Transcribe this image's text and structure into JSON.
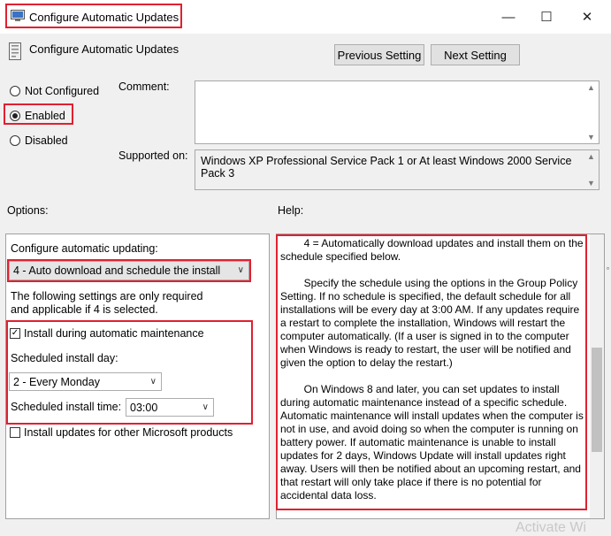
{
  "window": {
    "title": "Configure Automatic Updates",
    "controls": {
      "minimize": "—",
      "maximize": "☐",
      "close": "✕"
    }
  },
  "header": {
    "policy_name": "Configure Automatic Updates",
    "previous_label": "Previous Setting",
    "next_label": "Next Setting"
  },
  "state": {
    "options": [
      {
        "label": "Not Configured",
        "selected": false
      },
      {
        "label": "Enabled",
        "selected": true
      },
      {
        "label": "Disabled",
        "selected": false
      }
    ]
  },
  "comment": {
    "label": "Comment:",
    "value": ""
  },
  "supported": {
    "label": "Supported on:",
    "value": "Windows XP Professional Service Pack 1 or At least Windows 2000 Service Pack 3"
  },
  "options_section": {
    "label": "Options:",
    "configure_label": "Configure automatic updating:",
    "configure_value": "4 - Auto download and schedule the install",
    "note": "The following settings are only required and applicable if 4 is selected.",
    "maintenance_checkbox": {
      "label": "Install during automatic maintenance",
      "checked": true
    },
    "install_day_label": "Scheduled install day:",
    "install_day_value": "2 - Every Monday",
    "install_time_label": "Scheduled install time:",
    "install_time_value": "03:00",
    "other_products_checkbox": {
      "label": "Install updates for other Microsoft products",
      "checked": false
    }
  },
  "help": {
    "label": "Help:",
    "para1": "        4 = Automatically download updates and install them on the schedule specified below.",
    "para2": "        Specify the schedule using the options in the Group Policy Setting. If no schedule is specified, the default schedule for all installations will be every day at 3:00 AM. If any updates require a restart to complete the installation, Windows will restart the computer automatically. (If a user is signed in to the computer when Windows is ready to restart, the user will be notified and given the option to delay the restart.)",
    "para3": "        On Windows 8 and later, you can set updates to install during automatic maintenance instead of a specific schedule. Automatic maintenance will install updates when the computer is not in use, and avoid doing so when the computer is running on battery power. If automatic maintenance is unable to install updates for 2 days, Windows Update will install updates right away. Users will then be notified about an upcoming restart, and that restart will only take place if there is no potential for accidental data loss."
  },
  "watermark": "Activate Wi",
  "colors": {
    "highlight": "#e02030",
    "background": "#f0f0f0"
  }
}
